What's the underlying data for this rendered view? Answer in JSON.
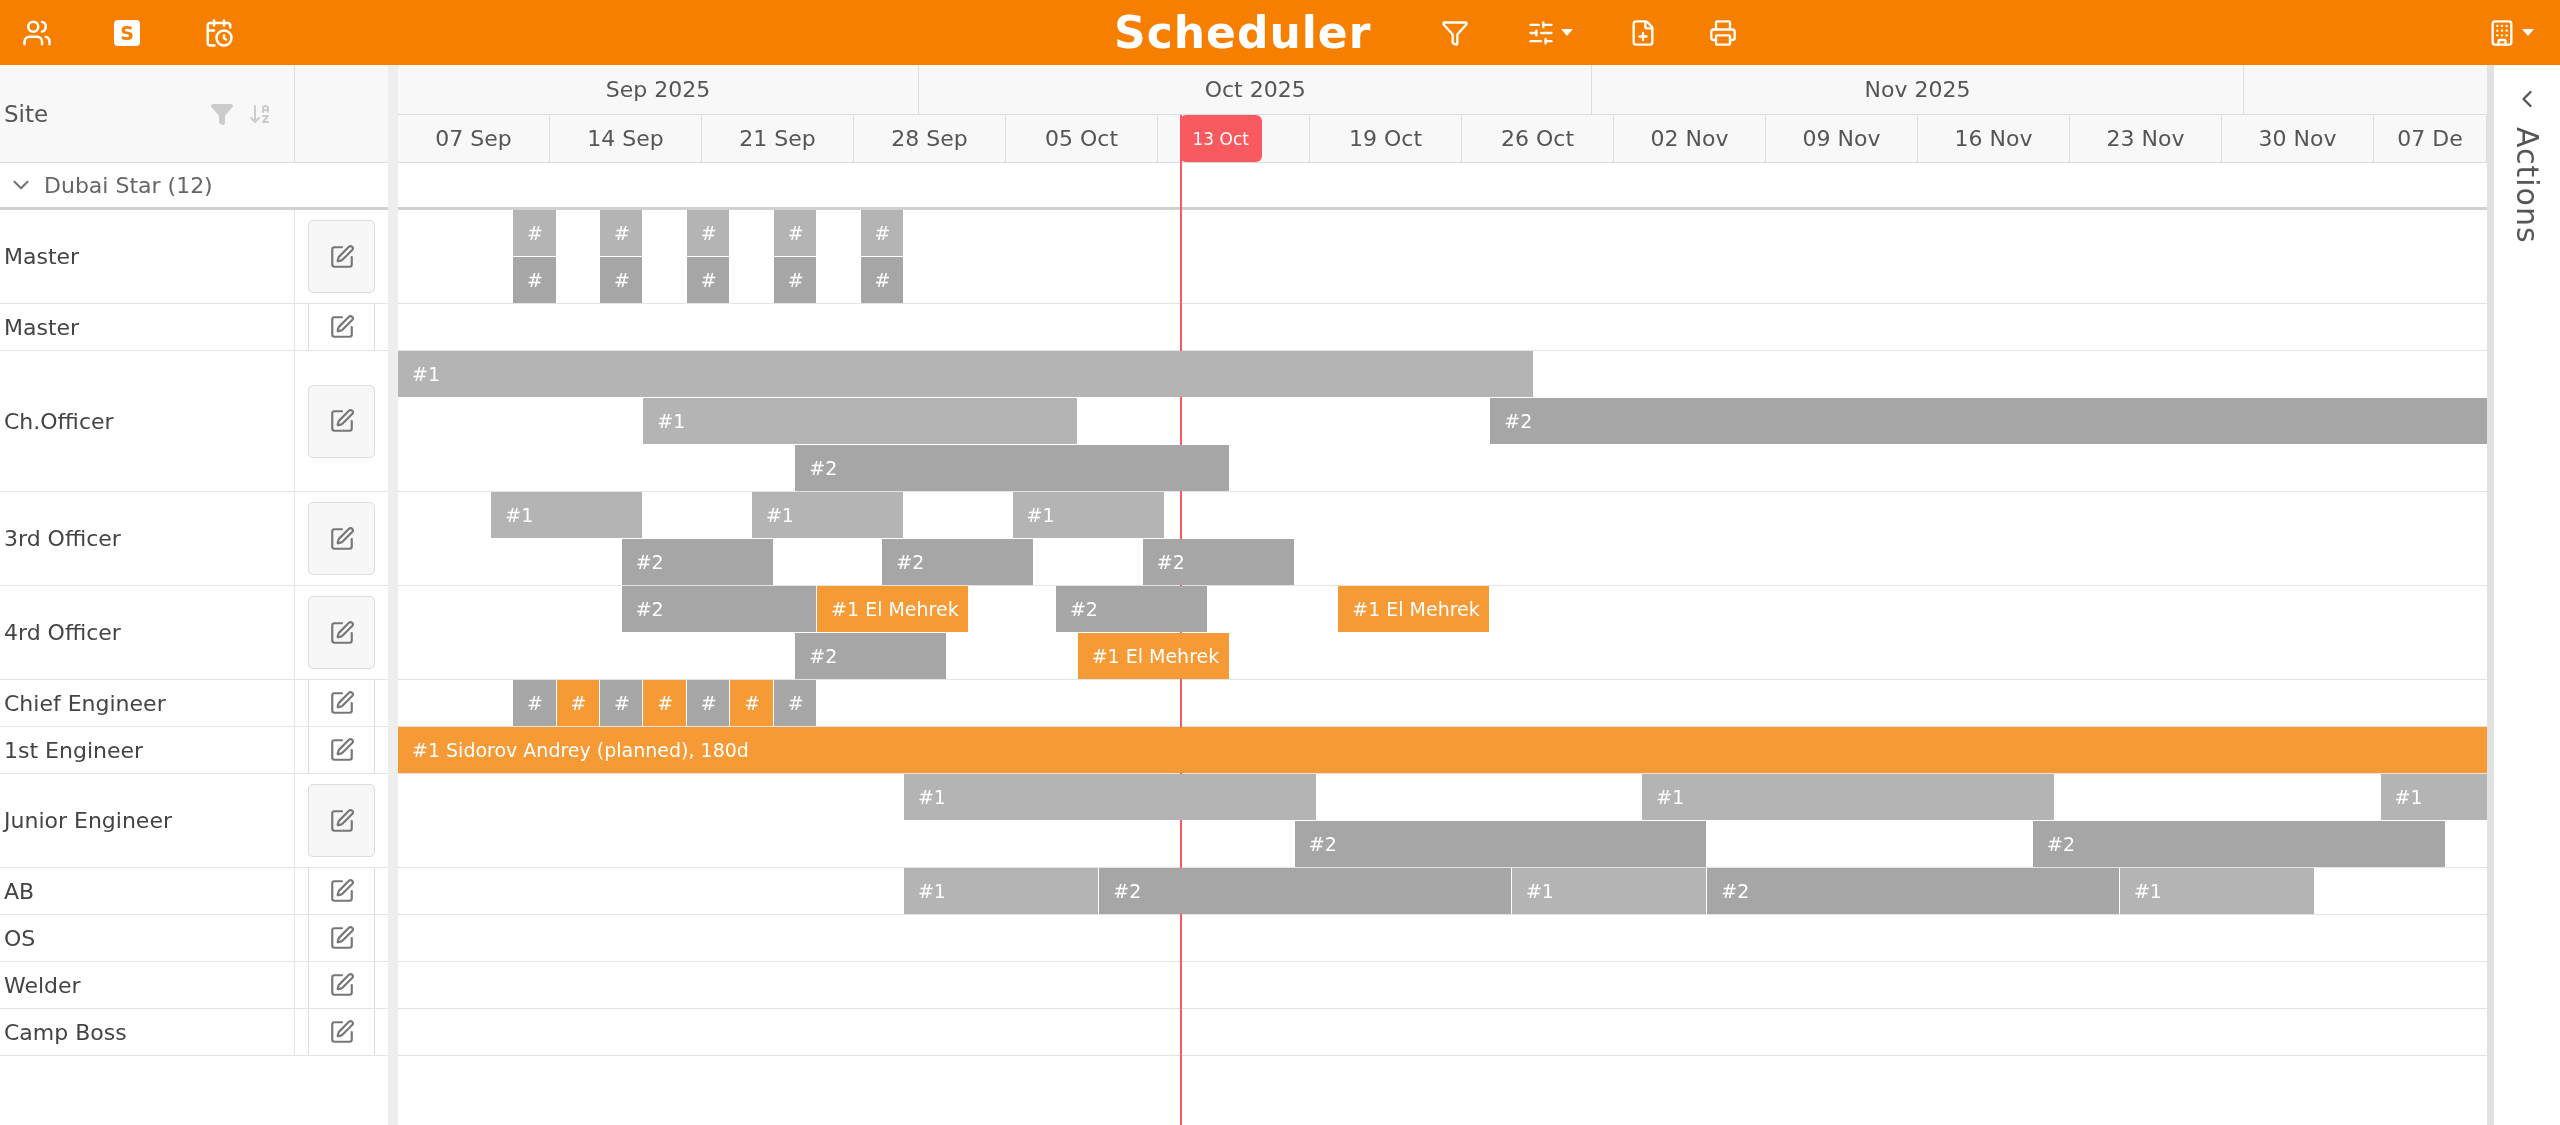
{
  "top_bar": {
    "badge_letter": "S",
    "title": "Scheduler"
  },
  "site_header": {
    "label": "Site"
  },
  "timeline": {
    "months": [
      {
        "label": "Sep 2025"
      },
      {
        "label": "Oct 2025"
      },
      {
        "label": "Nov 2025"
      }
    ],
    "weeks": [
      {
        "label": "07 Sep",
        "today": false
      },
      {
        "label": "14 Sep",
        "today": false
      },
      {
        "label": "21 Sep",
        "today": false
      },
      {
        "label": "28 Sep",
        "today": false
      },
      {
        "label": "05 Oct",
        "today": false
      },
      {
        "label": "13 Oct",
        "today": true
      },
      {
        "label": "19 Oct",
        "today": false
      },
      {
        "label": "26 Oct",
        "today": false
      },
      {
        "label": "02 Nov",
        "today": false
      },
      {
        "label": "09 Nov",
        "today": false
      },
      {
        "label": "16 Nov",
        "today": false
      },
      {
        "label": "23 Nov",
        "today": false
      },
      {
        "label": "30 Nov",
        "today": false
      },
      {
        "label": "07 De",
        "today": false
      }
    ]
  },
  "group": {
    "label": "Dubai Star (12)",
    "expanded": true
  },
  "rows": [
    {
      "label": "Master",
      "bars": [
        {
          "label": "#",
          "color": "#b4b4b4"
        },
        {
          "label": "#",
          "color": "#b4b4b4"
        },
        {
          "label": "#",
          "color": "#b4b4b4"
        },
        {
          "label": "#",
          "color": "#b4b4b4"
        },
        {
          "label": "#",
          "color": "#b4b4b4"
        },
        {
          "label": "#",
          "color": "#a6a6a6"
        },
        {
          "label": "#",
          "color": "#a6a6a6"
        },
        {
          "label": "#",
          "color": "#a6a6a6"
        },
        {
          "label": "#",
          "color": "#a6a6a6"
        },
        {
          "label": "#",
          "color": "#a6a6a6"
        }
      ]
    },
    {
      "label": "Master",
      "bars": []
    },
    {
      "label": "Ch.Officer",
      "bars": [
        {
          "label": "#1",
          "color": "#b4b4b4"
        },
        {
          "label": "#1",
          "color": "#b4b4b4"
        },
        {
          "label": "#2",
          "color": "#a6a6a6"
        },
        {
          "label": "#2",
          "color": "#a6a6a6"
        }
      ]
    },
    {
      "label": "3rd Officer",
      "bars": [
        {
          "label": "#1",
          "color": "#b4b4b4"
        },
        {
          "label": "#1",
          "color": "#b4b4b4"
        },
        {
          "label": "#1",
          "color": "#b4b4b4"
        },
        {
          "label": "#2",
          "color": "#a6a6a6"
        },
        {
          "label": "#2",
          "color": "#a6a6a6"
        },
        {
          "label": "#2",
          "color": "#a6a6a6"
        }
      ]
    },
    {
      "label": "4rd Officer",
      "bars": [
        {
          "label": "#2",
          "color": "#a6a6a6"
        },
        {
          "label": "#1 El Mehrek",
          "color": "#f59a35"
        },
        {
          "label": "#2",
          "color": "#a6a6a6"
        },
        {
          "label": "#1 El Mehrek",
          "color": "#f59a35"
        },
        {
          "label": "#2",
          "color": "#a6a6a6"
        },
        {
          "label": "#1 El Mehrek",
          "color": "#f59a35"
        }
      ]
    },
    {
      "label": "Chief Engineer",
      "bars": [
        {
          "label": "#",
          "color": "#a6a6a6"
        },
        {
          "label": "#",
          "color": "#f59a35"
        },
        {
          "label": "#",
          "color": "#a6a6a6"
        },
        {
          "label": "#",
          "color": "#f59a35"
        },
        {
          "label": "#",
          "color": "#a6a6a6"
        },
        {
          "label": "#",
          "color": "#f59a35"
        },
        {
          "label": "#",
          "color": "#a6a6a6"
        }
      ]
    },
    {
      "label": "1st Engineer",
      "bars": [
        {
          "label": "#1 Sidorov Andrey (planned), 180d",
          "color": "#f59a35"
        }
      ]
    },
    {
      "label": "Junior Engineer",
      "bars": [
        {
          "label": "#1",
          "color": "#b4b4b4"
        },
        {
          "label": "#1",
          "color": "#b4b4b4"
        },
        {
          "label": "#1",
          "color": "#b4b4b4"
        },
        {
          "label": "#2",
          "color": "#a6a6a6"
        },
        {
          "label": "#2",
          "color": "#a6a6a6"
        }
      ]
    },
    {
      "label": "AB",
      "bars": [
        {
          "label": "#1",
          "color": "#b4b4b4"
        },
        {
          "label": "#2",
          "color": "#a6a6a6"
        },
        {
          "label": "#1",
          "color": "#b4b4b4"
        },
        {
          "label": "#2",
          "color": "#a6a6a6"
        },
        {
          "label": "#1",
          "color": "#b4b4b4"
        }
      ]
    },
    {
      "label": "OS",
      "bars": []
    },
    {
      "label": "Welder",
      "bars": []
    },
    {
      "label": "Camp Boss",
      "bars": []
    }
  ],
  "actions_panel": {
    "label": "Actions"
  }
}
